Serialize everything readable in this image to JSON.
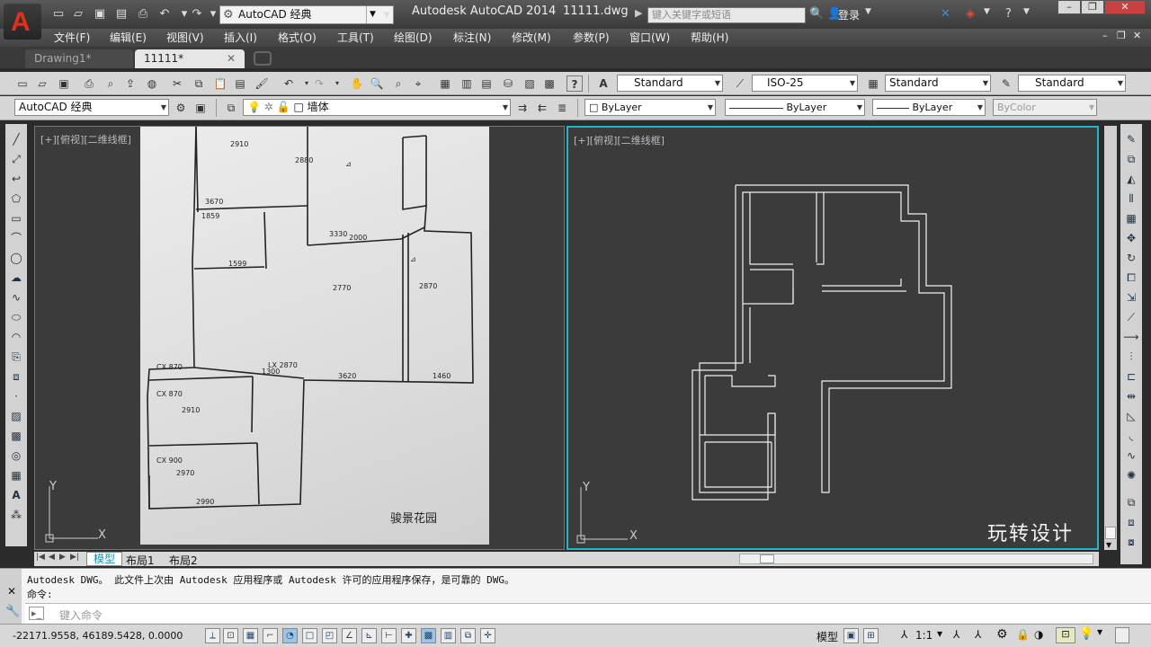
{
  "title_bar": {
    "app_title": "Autodesk AutoCAD 2014",
    "file_title": "11111.dwg",
    "workspace": "AutoCAD 经典",
    "search_placeholder": "键入关键字或短语",
    "login_label": "登录"
  },
  "menu": [
    "文件(F)",
    "编辑(E)",
    "视图(V)",
    "插入(I)",
    "格式(O)",
    "工具(T)",
    "绘图(D)",
    "标注(N)",
    "修改(M)",
    "参数(P)",
    "窗口(W)",
    "帮助(H)"
  ],
  "doc_tabs": [
    {
      "label": "Drawing1*",
      "active": false
    },
    {
      "label": "11111*",
      "active": true
    }
  ],
  "styles_toolbar": {
    "text_style": "Standard",
    "dim_style": "ISO-25",
    "table_style": "Standard",
    "mleader_style": "Standard"
  },
  "layers_toolbar": {
    "workspace": "AutoCAD 经典",
    "current_layer": "墙体",
    "color": "ByLayer",
    "linetype": "ByLayer",
    "lineweight": "ByLayer",
    "plot_style": "ByColor"
  },
  "viewports": {
    "left_label": "[+][俯视][二维线框]",
    "right_label": "[+][俯视][二维线框]",
    "photo_caption": "骏景花园",
    "watermark": "玩转设计"
  },
  "ucs": {
    "x_label": "X",
    "y_label": "Y"
  },
  "layout_tabs": [
    "模型",
    "布局1",
    "布局2"
  ],
  "command": {
    "history": "Autodesk DWG。  此文件上次由 Autodesk 应用程序或 Autodesk 许可的应用程序保存，是可靠的 DWG。",
    "prompt": "命令:",
    "input_placeholder": "键入命令"
  },
  "status": {
    "coordinates": "-22171.9558, 46189.5428, 0.0000",
    "model_label": "模型",
    "annotation_scale": "1:1"
  },
  "colors": {
    "accent": "#24b4c8",
    "logo_red": "#e03020",
    "viewport_bg": "#3b3b3b"
  }
}
